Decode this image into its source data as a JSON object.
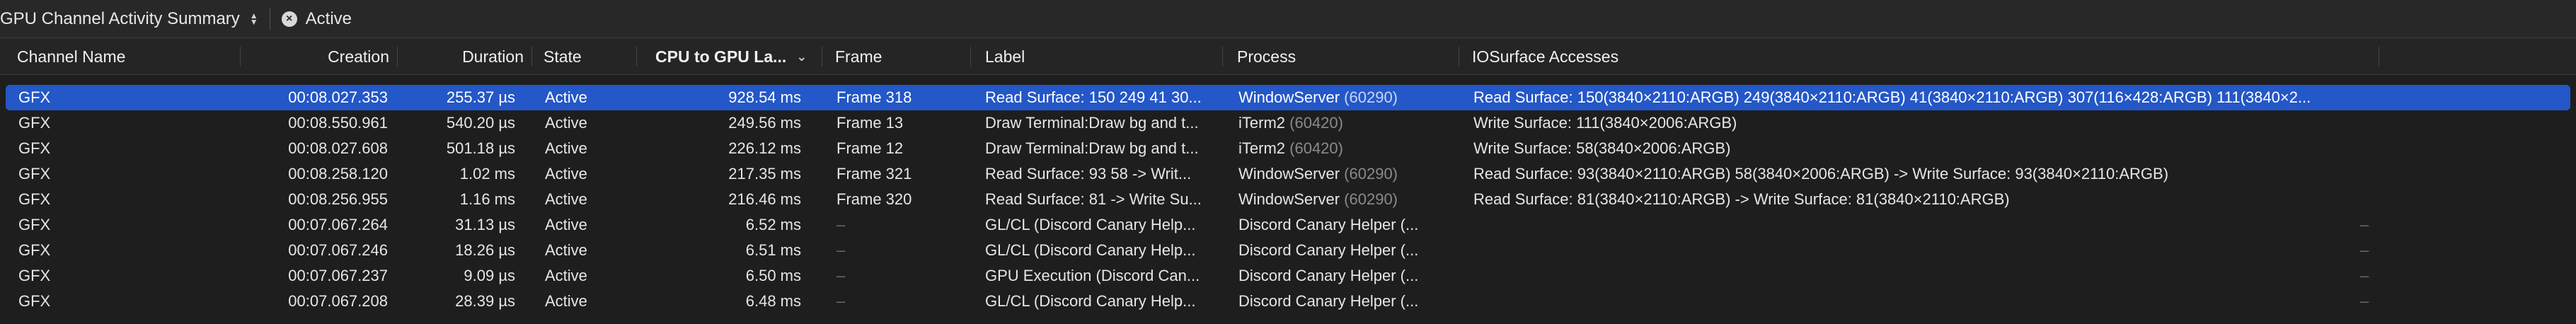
{
  "toolbar": {
    "title": "GPU Channel Activity Summary",
    "filter_label": "Active"
  },
  "columns": {
    "channel_name": "Channel Name",
    "creation": "Creation",
    "duration": "Duration",
    "state": "State",
    "cpu_to_gpu": "CPU to GPU La...",
    "frame": "Frame",
    "label": "Label",
    "process": "Process",
    "iosurface": "IOSurface Accesses"
  },
  "rows": [
    {
      "channel": "GFX",
      "creation": "00:08.027.353",
      "duration": "255.37 µs",
      "state": "Active",
      "latency": "928.54 ms",
      "frame": "Frame 318",
      "label": "Read Surface: 150 249 41 30...",
      "process": "WindowServer",
      "pid": "(60290)",
      "iosurface": "Read Surface: 150(3840×2110:ARGB) 249(3840×2110:ARGB) 41(3840×2110:ARGB) 307(116×428:ARGB) 111(3840×2..."
    },
    {
      "channel": "GFX",
      "creation": "00:08.550.961",
      "duration": "540.20 µs",
      "state": "Active",
      "latency": "249.56 ms",
      "frame": "Frame 13",
      "label": "Draw Terminal:Draw bg and t...",
      "process": "iTerm2",
      "pid": "(60420)",
      "iosurface": "Write Surface: 111(3840×2006:ARGB)"
    },
    {
      "channel": "GFX",
      "creation": "00:08.027.608",
      "duration": "501.18 µs",
      "state": "Active",
      "latency": "226.12 ms",
      "frame": "Frame 12",
      "label": "Draw Terminal:Draw bg and t...",
      "process": "iTerm2",
      "pid": "(60420)",
      "iosurface": "Write Surface: 58(3840×2006:ARGB)"
    },
    {
      "channel": "GFX",
      "creation": "00:08.258.120",
      "duration": "1.02 ms",
      "state": "Active",
      "latency": "217.35 ms",
      "frame": "Frame 321",
      "label": "Read Surface: 93 58 -> Writ...",
      "process": "WindowServer",
      "pid": "(60290)",
      "iosurface": "Read Surface: 93(3840×2110:ARGB) 58(3840×2006:ARGB) -> Write Surface: 93(3840×2110:ARGB)"
    },
    {
      "channel": "GFX",
      "creation": "00:08.256.955",
      "duration": "1.16 ms",
      "state": "Active",
      "latency": "216.46 ms",
      "frame": "Frame 320",
      "label": "Read Surface: 81 -> Write Su...",
      "process": "WindowServer",
      "pid": "(60290)",
      "iosurface": "Read Surface: 81(3840×2110:ARGB) -> Write Surface: 81(3840×2110:ARGB)"
    },
    {
      "channel": "GFX",
      "creation": "00:07.067.264",
      "duration": "31.13 µs",
      "state": "Active",
      "latency": "6.52 ms",
      "frame": "–",
      "label": "GL/CL (Discord Canary Help...",
      "process": "Discord Canary Helper (...",
      "pid": "",
      "iosurface": "",
      "trail": "–"
    },
    {
      "channel": "GFX",
      "creation": "00:07.067.246",
      "duration": "18.26 µs",
      "state": "Active",
      "latency": "6.51 ms",
      "frame": "–",
      "label": "GL/CL (Discord Canary Help...",
      "process": "Discord Canary Helper (...",
      "pid": "",
      "iosurface": "",
      "trail": "–"
    },
    {
      "channel": "GFX",
      "creation": "00:07.067.237",
      "duration": "9.09 µs",
      "state": "Active",
      "latency": "6.50 ms",
      "frame": "–",
      "label": "GPU Execution (Discord Can...",
      "process": "Discord Canary Helper (...",
      "pid": "",
      "iosurface": "",
      "trail": "–"
    },
    {
      "channel": "GFX",
      "creation": "00:07.067.208",
      "duration": "28.39 µs",
      "state": "Active",
      "latency": "6.48 ms",
      "frame": "–",
      "label": "GL/CL (Discord Canary Help...",
      "process": "Discord Canary Helper (...",
      "pid": "",
      "iosurface": "",
      "trail": "–"
    }
  ]
}
